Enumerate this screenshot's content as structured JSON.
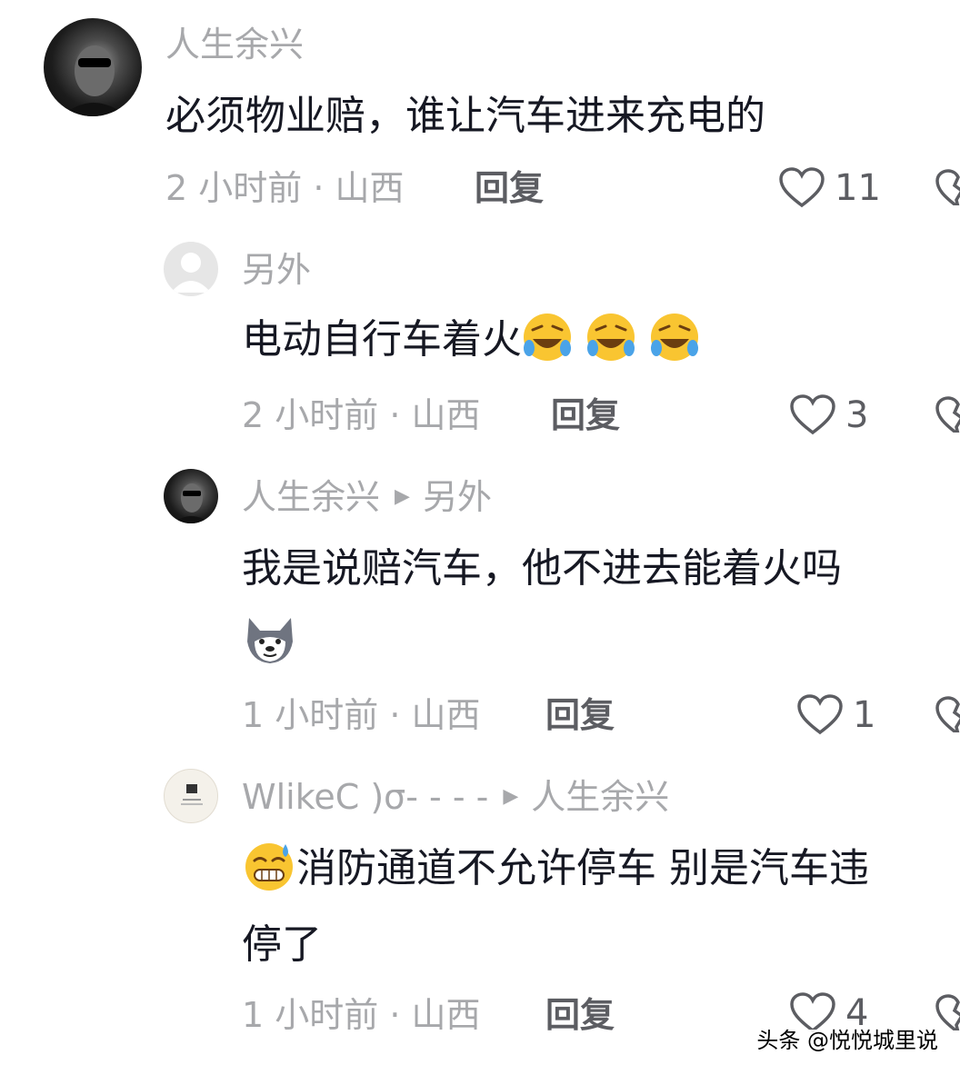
{
  "comments": [
    {
      "username": "人生余兴",
      "text": "必须物业赔，谁让汽车进来充电的",
      "meta": "2 小时前 · 山西",
      "reply_label": "回复",
      "likes": "11"
    },
    {
      "username": "另外",
      "text": "电动自行车着火",
      "meta": "2 小时前 · 山西",
      "reply_label": "回复",
      "likes": "3"
    },
    {
      "username": "人生余兴",
      "reply_to": "另外",
      "text": "我是说赔汽车，他不进去能着火吗",
      "meta": "1 小时前 · 山西",
      "reply_label": "回复",
      "likes": "1"
    },
    {
      "username": "WlikeC )σ- - - -",
      "reply_to": "人生余兴",
      "text_line1": "消防通道不允许停车 别是汽车违",
      "text_line2": "停了",
      "meta": "1 小时前 · 山西",
      "reply_label": "回复",
      "likes": "4"
    }
  ],
  "watermark": "头条 @悦悦城里说"
}
